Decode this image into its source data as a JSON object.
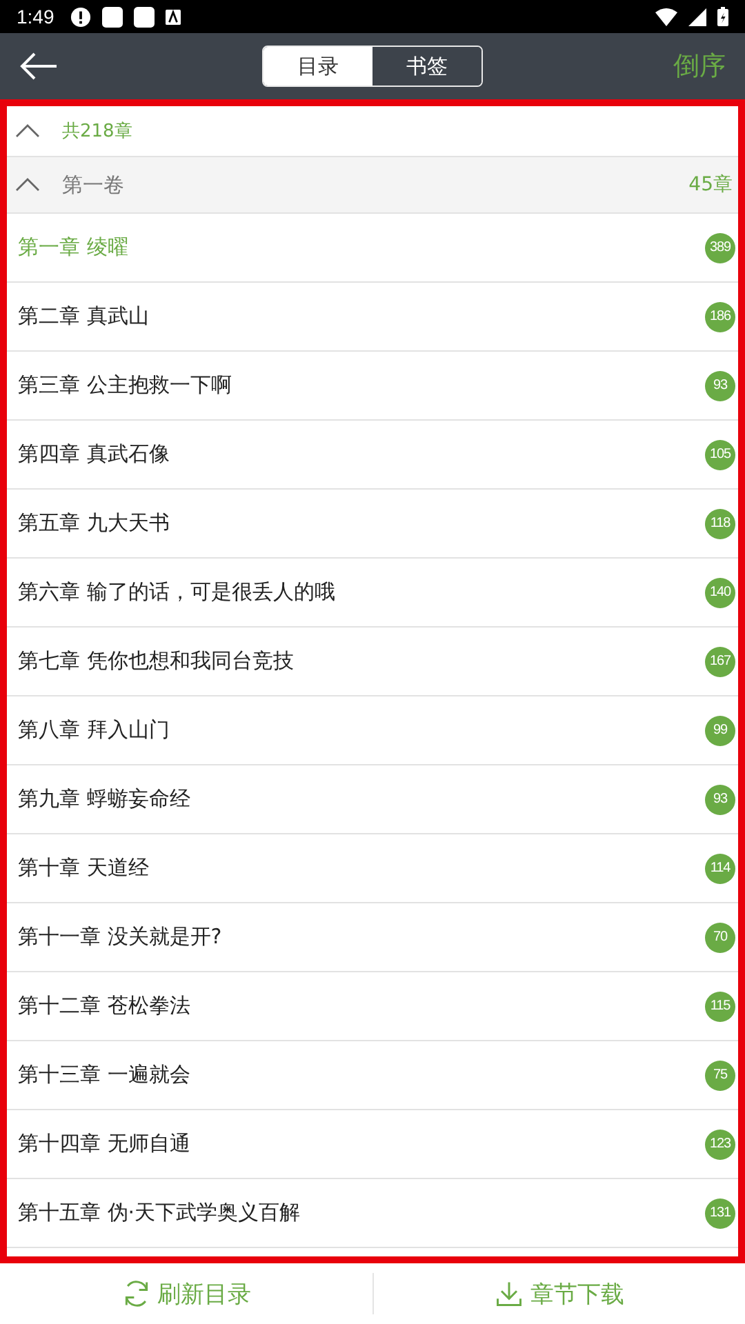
{
  "status_bar": {
    "time": "1:49"
  },
  "toolbar": {
    "tabs": [
      {
        "label": "目录",
        "selected": true
      },
      {
        "label": "书签",
        "selected": false
      }
    ],
    "action": "倒序"
  },
  "summary": {
    "label": "共218章",
    "expanded": true
  },
  "volume": {
    "title": "第一卷",
    "count": "45章",
    "expanded": true
  },
  "chapters": [
    {
      "title": "第一章 绫曜",
      "count": "389",
      "selected": true
    },
    {
      "title": "第二章 真武山",
      "count": "186",
      "selected": false
    },
    {
      "title": "第三章 公主抱救一下啊",
      "count": "93",
      "selected": false
    },
    {
      "title": "第四章 真武石像",
      "count": "105",
      "selected": false
    },
    {
      "title": "第五章 九大天书",
      "count": "118",
      "selected": false
    },
    {
      "title": "第六章 输了的话，可是很丢人的哦",
      "count": "140",
      "selected": false
    },
    {
      "title": "第七章 凭你也想和我同台竞技",
      "count": "167",
      "selected": false
    },
    {
      "title": "第八章 拜入山门",
      "count": "99",
      "selected": false
    },
    {
      "title": "第九章 蜉蝣妄命经",
      "count": "93",
      "selected": false
    },
    {
      "title": "第十章 天道经",
      "count": "114",
      "selected": false
    },
    {
      "title": "第十一章 没关就是开?",
      "count": "70",
      "selected": false
    },
    {
      "title": "第十二章 苍松拳法",
      "count": "115",
      "selected": false
    },
    {
      "title": "第十三章 一遍就会",
      "count": "75",
      "selected": false
    },
    {
      "title": "第十四章 无师自通",
      "count": "123",
      "selected": false
    },
    {
      "title": "第十五章 伪·天下武学奥义百解",
      "count": "131",
      "selected": false
    }
  ],
  "bottom_bar": [
    {
      "kind": "refresh",
      "label": "刷新目录"
    },
    {
      "kind": "download",
      "label": "章节下载"
    }
  ]
}
